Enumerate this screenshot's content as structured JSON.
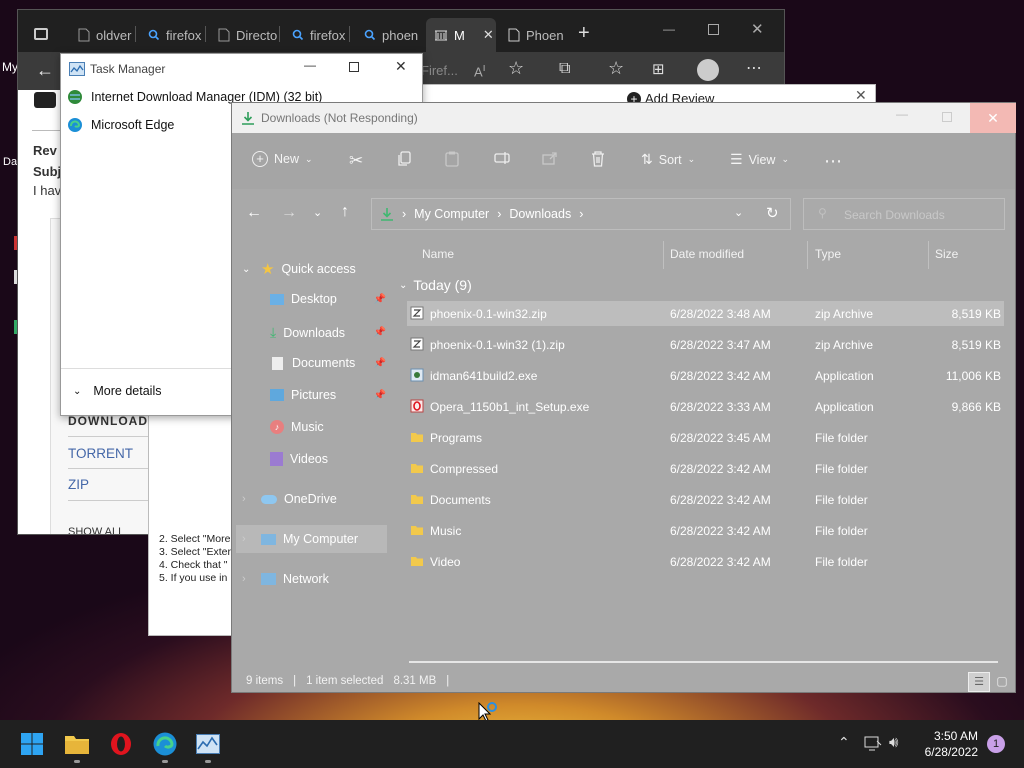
{
  "desktop": {
    "left_fragments": [
      "My",
      "Da"
    ]
  },
  "edge": {
    "tabs": [
      "oldver",
      "firefox",
      "Directo",
      "firefox",
      "phoen",
      "M",
      "Phoen"
    ],
    "address_fragment": "Firef..."
  },
  "page_fragments": {
    "add_review": "Add Review",
    "rev": "Rev",
    "subj": "Subj",
    "i_hav": "I hav",
    "download_options": "DOWNLOAD OPTIONS",
    "torrent": "TORRENT",
    "zip": "ZIP",
    "show_all": "SHOW ALL",
    "steps": [
      "2. Select \"More",
      "3. Select \"Exter",
      "4. Check that \"",
      "5. If you use in"
    ]
  },
  "task_manager": {
    "title": "Task Manager",
    "items": [
      "Internet Download Manager (IDM) (32 bit)",
      "Microsoft Edge"
    ],
    "more_details": "More details"
  },
  "explorer": {
    "title": "Downloads (Not Responding)",
    "commands": {
      "new": "New",
      "sort": "Sort",
      "view": "View"
    },
    "breadcrumb": [
      "My Computer",
      "Downloads"
    ],
    "search_placeholder": "Search Downloads",
    "nav": [
      {
        "label": "Quick access",
        "icon": "star-icon"
      },
      {
        "label": "Desktop",
        "icon": "desktop-icon"
      },
      {
        "label": "Downloads",
        "icon": "download-icon"
      },
      {
        "label": "Documents",
        "icon": "document-icon"
      },
      {
        "label": "Pictures",
        "icon": "pictures-icon"
      },
      {
        "label": "Music",
        "icon": "music-icon"
      },
      {
        "label": "Videos",
        "icon": "videos-icon"
      },
      {
        "label": "OneDrive",
        "icon": "cloud-icon"
      },
      {
        "label": "My Computer",
        "icon": "computer-icon"
      },
      {
        "label": "Network",
        "icon": "network-icon"
      }
    ],
    "columns": [
      "Name",
      "Date modified",
      "Type",
      "Size"
    ],
    "group_label": "Today (9)",
    "files": [
      {
        "name": "phoenix-0.1-win32.zip",
        "date": "6/28/2022 3:48 AM",
        "type": "zip Archive",
        "size": "8,519 KB"
      },
      {
        "name": "phoenix-0.1-win32 (1).zip",
        "date": "6/28/2022 3:47 AM",
        "type": "zip Archive",
        "size": "8,519 KB"
      },
      {
        "name": "idman641build2.exe",
        "date": "6/28/2022 3:42 AM",
        "type": "Application",
        "size": "11,006 KB"
      },
      {
        "name": "Opera_1150b1_int_Setup.exe",
        "date": "6/28/2022 3:33 AM",
        "type": "Application",
        "size": "9,866 KB"
      },
      {
        "name": "Programs",
        "date": "6/28/2022 3:45 AM",
        "type": "File folder",
        "size": ""
      },
      {
        "name": "Compressed",
        "date": "6/28/2022 3:42 AM",
        "type": "File folder",
        "size": ""
      },
      {
        "name": "Documents",
        "date": "6/28/2022 3:42 AM",
        "type": "File folder",
        "size": ""
      },
      {
        "name": "Music",
        "date": "6/28/2022 3:42 AM",
        "type": "File folder",
        "size": ""
      },
      {
        "name": "Video",
        "date": "6/28/2022 3:42 AM",
        "type": "File folder",
        "size": ""
      }
    ],
    "status": {
      "items": "9 items",
      "selected": "1 item selected",
      "size": "8.31 MB"
    }
  },
  "taskbar": {
    "time": "3:50 AM",
    "date": "6/28/2022",
    "notifications": "1"
  },
  "colors": {
    "accent": "#0078d4",
    "folder": "#f2c94c",
    "opera": "#e0141e"
  }
}
